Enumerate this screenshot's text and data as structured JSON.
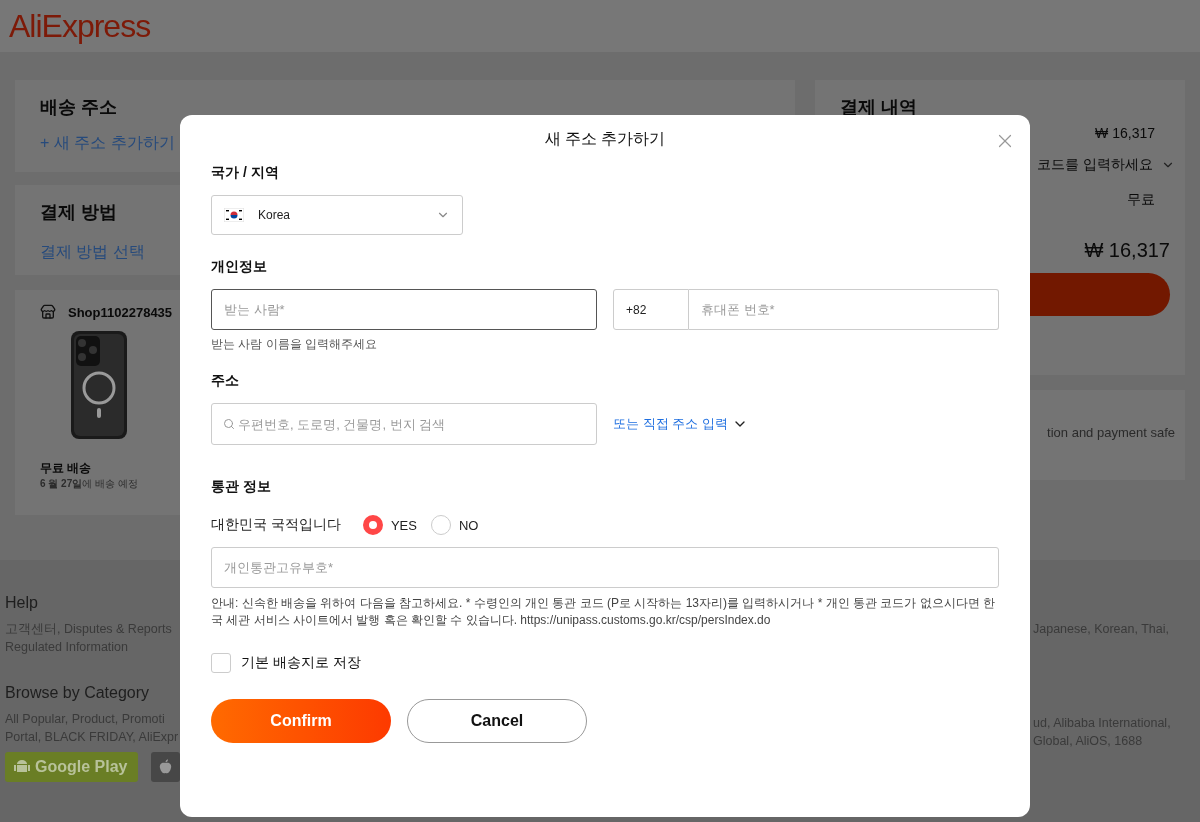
{
  "header": {
    "logo": "AliExpress"
  },
  "shipping_card": {
    "title": "배송 주소",
    "add_link": "+ 새 주소 추가하기"
  },
  "payment_card": {
    "title": "결제 방법",
    "link": "결제 방법 선택"
  },
  "order_card": {
    "shop": "Shop1102278435",
    "shipping": "무료 배송",
    "delivery": "**6 월 27일**에 배송 예정"
  },
  "summary_card": {
    "title": "결제 내역",
    "subtotal": "₩ 16,317",
    "promo_code": "코드를 입력하세요",
    "shipping": "무료",
    "total": "₩ 16,317"
  },
  "safety_card": {
    "text": "tion and payment safe"
  },
  "footer": {
    "sections": [
      {
        "title": "Help",
        "lines": [
          "고객센터, Disputes & Reports",
          "Regulated Information"
        ],
        "right_lines": [
          "Japanese, Korean, Thai,"
        ]
      },
      {
        "title": "Browse by Category",
        "lines": [
          "All Popular, Product, Promoti",
          "Portal, BLACK FRIDAY, AliExpr"
        ],
        "right_lines": [
          "ud, Alibaba International,",
          "Global, AliOS, 1688"
        ]
      }
    ],
    "app_badges": [
      {
        "kind": "google",
        "label": "Google Play"
      },
      {
        "kind": "apple"
      }
    ]
  },
  "dialog": {
    "title": "새 주소 추가하기",
    "country": {
      "label": "국가 / 지역",
      "value": "Korea"
    },
    "personal": {
      "label": "개인정보",
      "name_field": {
        "placeholder": "받는 사람*",
        "focused": true,
        "hint": "받는 사람 이름을 입력해주세요"
      },
      "phone_code": "+82",
      "phone_field": {
        "placeholder": "휴대폰 번호*",
        "focused": false
      }
    },
    "address": {
      "label": "주소",
      "search_field": {
        "placeholder": "우편번호, 도로명, 건물명, 번지 검색"
      },
      "manual_link": "또는 직접 주소 입력"
    },
    "customs": {
      "label": "통관 정보",
      "question": "대한민국 국적입니다",
      "options": [
        {
          "label": "YES",
          "selected": true
        },
        {
          "label": "NO",
          "selected": false
        }
      ],
      "code_field": {
        "placeholder": "개인통관고유부호*"
      },
      "notice": "안내: 신속한 배송을 위하여 다음을 참고하세요. * 수령인의 개인 통관 코드 (P로 시작하는 13자리)를 입력하시거나 * 개인 통관 코드가 없으시다면 한국 세관 서비스 사이트에서 발행 혹은 확인할 수 있습니다. https://unipass.customs.go.kr/csp/persIndex.do"
    },
    "save_default": {
      "label": "기본 배송지로 저장",
      "checked": false
    },
    "buttons": [
      {
        "kind": "primary",
        "label": "Confirm"
      },
      {
        "kind": "secondary",
        "label": "Cancel"
      }
    ]
  }
}
